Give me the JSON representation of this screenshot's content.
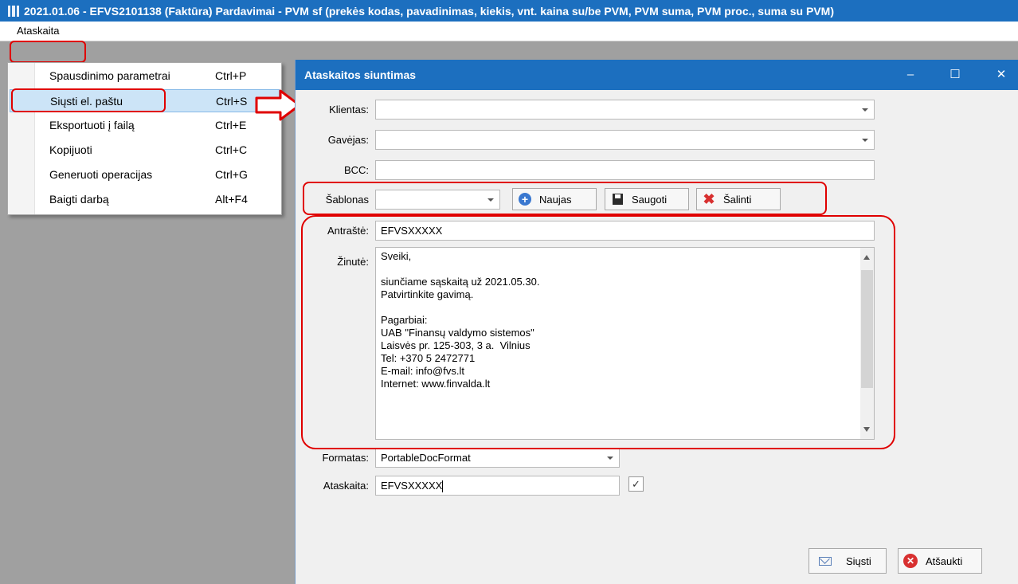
{
  "window": {
    "title": "2021.01.06 - EFVS2101138 (Faktūra) Pardavimai - PVM sf (prekės kodas, pavadinimas, kiekis, vnt. kaina su/be PVM, PVM suma, PVM proc., suma su PVM)"
  },
  "menubar": {
    "ataskaita": "Ataskaita"
  },
  "menu": {
    "items": [
      {
        "label": "Spausdinimo parametrai",
        "shortcut": "Ctrl+P"
      },
      {
        "label": "Siųsti el. paštu",
        "shortcut": "Ctrl+S"
      },
      {
        "label": "Eksportuoti į failą",
        "shortcut": "Ctrl+E"
      },
      {
        "label": "Kopijuoti",
        "shortcut": "Ctrl+C"
      },
      {
        "label": "Generuoti operacijas",
        "shortcut": "Ctrl+G"
      },
      {
        "label": "Baigti darbą",
        "shortcut": "Alt+F4"
      }
    ]
  },
  "dialog": {
    "title": "Ataskaitos siuntimas",
    "controls": {
      "minimize": "–",
      "maximize": "☐",
      "close": "✕"
    },
    "klientas": {
      "label": "Klientas:",
      "value": ""
    },
    "gavejas": {
      "label": "Gavėjas:",
      "value": ""
    },
    "bcc": {
      "label": "BCC:",
      "value": ""
    },
    "sablonas": {
      "label": "Šablonas",
      "value": ""
    },
    "buttons": {
      "naujas": "Naujas",
      "saugoti": "Saugoti",
      "salinti": "Šalinti"
    },
    "antraste": {
      "label": "Antraštė:",
      "value": "EFVSXXXXX"
    },
    "zinute": {
      "label": "Žinutė:",
      "value": "Sveiki,\n\nsiunčiame sąskaitą už 2021.05.30.\nPatvirtinkite gavimą.\n\nPagarbiai:\nUAB \"Finansų valdymo sistemos\"\nLaisvės pr. 125-303, 3 a.  Vilnius\nTel: +370 5 2472771\nE-mail: info@fvs.lt\nInternet: www.finvalda.lt"
    },
    "formatas": {
      "label": "Formatas:",
      "value": "PortableDocFormat"
    },
    "ataskaita": {
      "label": "Ataskaita:",
      "value": "EFVSXXXXX",
      "checked": true,
      "check_mark": "✓"
    },
    "send": "Siųsti",
    "cancel": "Atšaukti"
  }
}
